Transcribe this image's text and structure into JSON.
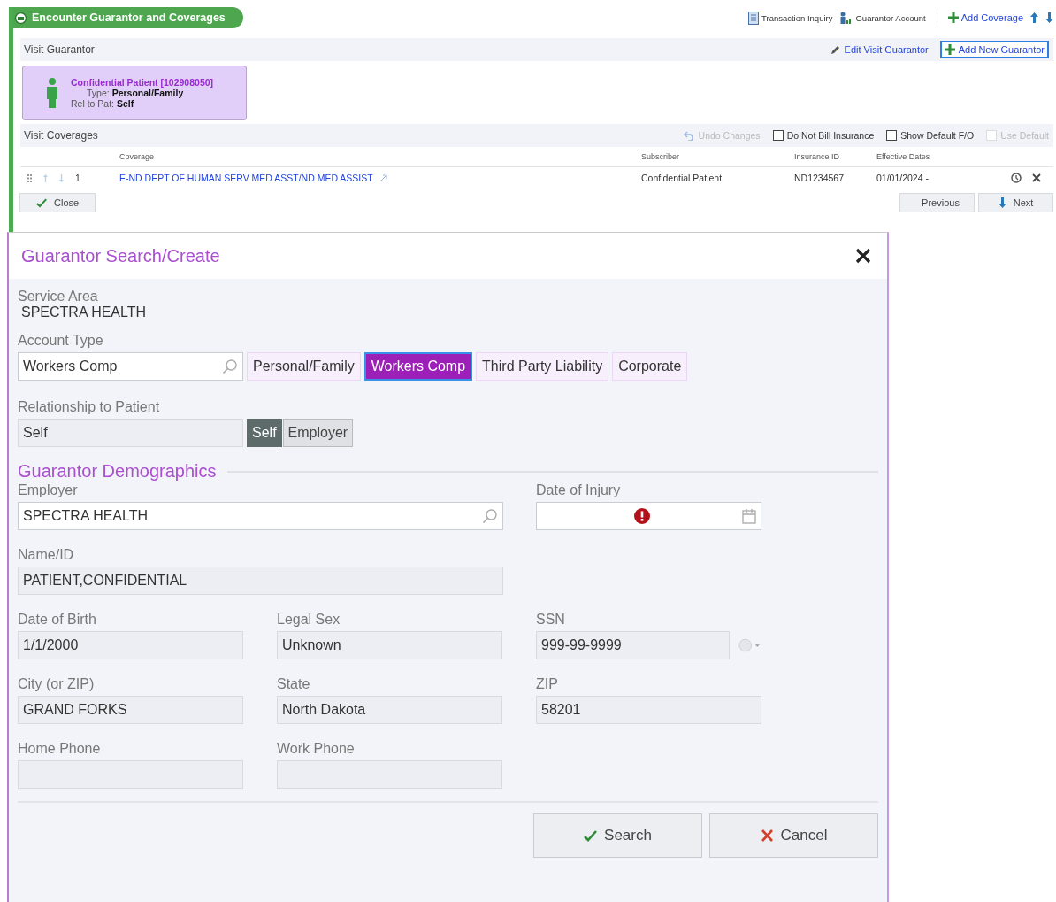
{
  "encounter_panel": {
    "title": "Encounter Guarantor and Coverages",
    "top_actions": [
      {
        "kind": "document",
        "label": "Transaction Inquiry"
      },
      {
        "kind": "account",
        "label": "Guarantor Account"
      },
      {
        "kind": "add",
        "label": "Add Coverage"
      }
    ],
    "visit_guarantor": {
      "heading": "Visit Guarantor",
      "actions": [
        {
          "kind": "edit",
          "label": "Edit Visit Guarantor",
          "focused": false
        },
        {
          "kind": "add",
          "label": "Add New Guarantor",
          "focused": true
        }
      ],
      "card": {
        "name": "Confidential Patient [102908050]",
        "type_label": "Type:",
        "type": "Personal/Family",
        "rel_label": "Rel to Pat:",
        "rel": "Self"
      }
    },
    "visit_coverages": {
      "heading": "Visit Coverages",
      "options": [
        {
          "kind": "undo",
          "label": "Undo Changes",
          "disabled": true
        },
        {
          "kind": "checkbox",
          "label": "Do Not Bill Insurance",
          "checked": false,
          "disabled": false
        },
        {
          "kind": "checkbox",
          "label": "Show Default F/O",
          "checked": false,
          "disabled": false
        },
        {
          "kind": "checkbox",
          "label": "Use Default",
          "checked": false,
          "disabled": true
        }
      ],
      "columns": [
        "Coverage",
        "Subscriber",
        "Insurance ID",
        "Effective Dates"
      ],
      "rows": [
        {
          "rank": "1",
          "coverage": "E-ND DEPT OF HUMAN SERV MED ASST/ND MED ASSIST",
          "subscriber": "Confidential Patient",
          "insurance_id": "ND1234567",
          "effective_dates": "01/01/2024 -"
        }
      ]
    },
    "close_button": "Close",
    "nav_buttons": [
      {
        "kind": "up",
        "label": "Previous"
      },
      {
        "kind": "down",
        "label": "Next"
      }
    ]
  },
  "dialog": {
    "title": "Guarantor Search/Create",
    "service_area": {
      "label": "Service Area",
      "value": "SPECTRA HEALTH"
    },
    "account_type": {
      "label": "Account Type",
      "value": "Workers Comp",
      "options": [
        {
          "label": "Personal/Family",
          "selected": false
        },
        {
          "label": "Workers Comp",
          "selected": true
        },
        {
          "label": "Third Party Liability",
          "selected": false
        },
        {
          "label": "Corporate",
          "selected": false
        }
      ]
    },
    "relationship": {
      "label": "Relationship to Patient",
      "value": "Self",
      "options": [
        {
          "label": "Self",
          "selected": true
        },
        {
          "label": "Employer",
          "selected": false
        }
      ]
    },
    "demographics": {
      "heading": "Guarantor Demographics",
      "rows": [
        [
          {
            "kind": "lookup",
            "label": "Employer",
            "value": "SPECTRA HEALTH"
          },
          "",
          {
            "kind": "date",
            "label": "Date of Injury",
            "required": true
          }
        ],
        [
          {
            "kind": "wide",
            "label": "Name/ID",
            "value": "PATIENT,CONFIDENTIAL"
          }
        ],
        [
          {
            "kind": "text",
            "label": "Date of Birth",
            "value": "1/1/2000"
          },
          {
            "kind": "text",
            "label": "Legal Sex",
            "value": "Unknown"
          },
          {
            "kind": "ssn",
            "label": "SSN",
            "value": "999-99-9999"
          }
        ],
        [
          {
            "kind": "text",
            "label": "City (or ZIP)",
            "value": "GRAND FORKS"
          },
          {
            "kind": "text",
            "label": "State",
            "value": "North Dakota"
          },
          {
            "kind": "text",
            "label": "ZIP",
            "value": "58201"
          }
        ],
        [
          {
            "kind": "text",
            "label": "Home Phone"
          },
          {
            "kind": "text",
            "label": "Work Phone"
          }
        ]
      ]
    },
    "buttons": [
      {
        "kind": "search",
        "label": "Search"
      },
      {
        "kind": "cancel",
        "label": "Cancel"
      }
    ]
  }
}
